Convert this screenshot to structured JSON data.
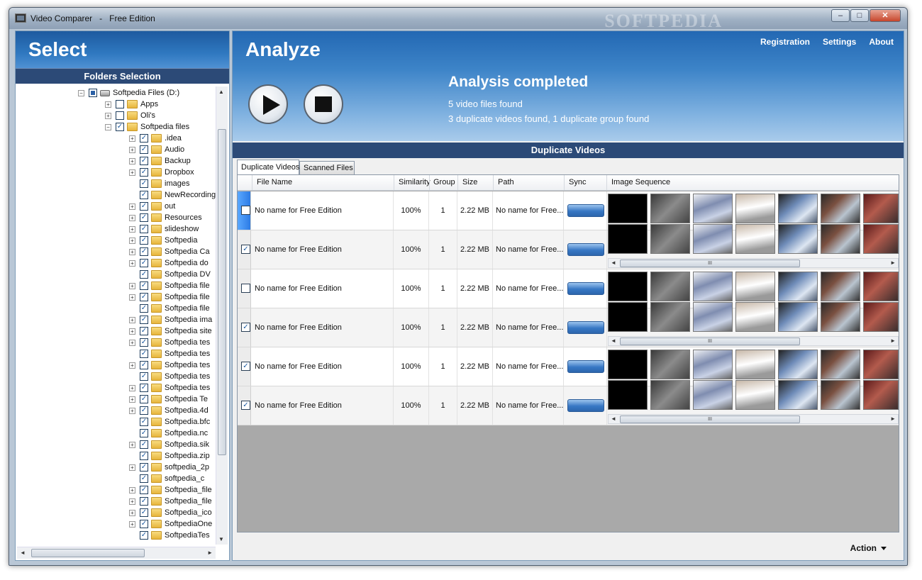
{
  "window": {
    "title": "Video Comparer   -   Free Edition"
  },
  "window_controls": {
    "minimize": "‒",
    "maximize": "□",
    "close": "✕"
  },
  "watermark": "SOFTPEDIA",
  "left_panel": {
    "heading": "Select",
    "subheading": "Folders Selection",
    "tree": [
      {
        "label": "Softpedia Files (D:)",
        "level": 0,
        "type": "drive",
        "expander": "−",
        "check": "partial"
      },
      {
        "label": "Apps",
        "level": 1,
        "type": "folder",
        "expander": "+",
        "check": "none"
      },
      {
        "label": "Oli's",
        "level": 1,
        "type": "folder",
        "expander": "+",
        "check": "none"
      },
      {
        "label": "Softpedia files",
        "level": 1,
        "type": "folder",
        "expander": "−",
        "check": "checked"
      },
      {
        "label": ".idea",
        "level": 2,
        "type": "folder",
        "expander": "+",
        "check": "checked"
      },
      {
        "label": "Audio",
        "level": 2,
        "type": "folder",
        "expander": "+",
        "check": "checked"
      },
      {
        "label": "Backup",
        "level": 2,
        "type": "folder",
        "expander": "+",
        "check": "checked"
      },
      {
        "label": "Dropbox",
        "level": 2,
        "type": "folder",
        "expander": "+",
        "check": "checked"
      },
      {
        "label": "images",
        "level": 2,
        "type": "folder",
        "expander": "",
        "check": "checked"
      },
      {
        "label": "NewRecording",
        "level": 2,
        "type": "folder",
        "expander": "",
        "check": "checked"
      },
      {
        "label": "out",
        "level": 2,
        "type": "folder",
        "expander": "+",
        "check": "checked"
      },
      {
        "label": "Resources",
        "level": 2,
        "type": "folder",
        "expander": "+",
        "check": "checked"
      },
      {
        "label": "slideshow",
        "level": 2,
        "type": "folder",
        "expander": "+",
        "check": "checked"
      },
      {
        "label": "Softpedia",
        "level": 2,
        "type": "folder",
        "expander": "+",
        "check": "checked"
      },
      {
        "label": "Softpedia Ca",
        "level": 2,
        "type": "folder",
        "expander": "+",
        "check": "checked"
      },
      {
        "label": "Softpedia do",
        "level": 2,
        "type": "folder",
        "expander": "+",
        "check": "checked"
      },
      {
        "label": "Softpedia DV",
        "level": 2,
        "type": "folder",
        "expander": "",
        "check": "checked"
      },
      {
        "label": "Softpedia file",
        "level": 2,
        "type": "folder",
        "expander": "+",
        "check": "checked"
      },
      {
        "label": "Softpedia file",
        "level": 2,
        "type": "folder",
        "expander": "+",
        "check": "checked"
      },
      {
        "label": "Softpedia file",
        "level": 2,
        "type": "folder",
        "expander": "",
        "check": "checked"
      },
      {
        "label": "Softpedia ima",
        "level": 2,
        "type": "folder",
        "expander": "+",
        "check": "checked"
      },
      {
        "label": "Softpedia site",
        "level": 2,
        "type": "folder",
        "expander": "+",
        "check": "checked"
      },
      {
        "label": "Softpedia tes",
        "level": 2,
        "type": "folder",
        "expander": "+",
        "check": "checked"
      },
      {
        "label": "Softpedia tes",
        "level": 2,
        "type": "folder",
        "expander": "",
        "check": "checked"
      },
      {
        "label": "Softpedia tes",
        "level": 2,
        "type": "folder",
        "expander": "+",
        "check": "checked"
      },
      {
        "label": "Softpedia tes",
        "level": 2,
        "type": "folder",
        "expander": "",
        "check": "checked"
      },
      {
        "label": "Softpedia tes",
        "level": 2,
        "type": "folder",
        "expander": "+",
        "check": "checked"
      },
      {
        "label": "Softpedia Te",
        "level": 2,
        "type": "folder",
        "expander": "+",
        "check": "checked"
      },
      {
        "label": "Softpedia.4d",
        "level": 2,
        "type": "folder",
        "expander": "+",
        "check": "checked"
      },
      {
        "label": "Softpedia.bfc",
        "level": 2,
        "type": "folder",
        "expander": "",
        "check": "checked"
      },
      {
        "label": "Softpedia.nc",
        "level": 2,
        "type": "folder",
        "expander": "",
        "check": "checked"
      },
      {
        "label": "Softpedia.sik",
        "level": 2,
        "type": "folder",
        "expander": "+",
        "check": "checked"
      },
      {
        "label": "Softpedia.zip",
        "level": 2,
        "type": "folder",
        "expander": "",
        "check": "checked"
      },
      {
        "label": "softpedia_2p",
        "level": 2,
        "type": "folder",
        "expander": "+",
        "check": "checked"
      },
      {
        "label": "softpedia_c",
        "level": 2,
        "type": "folder",
        "expander": "",
        "check": "checked"
      },
      {
        "label": "Softpedia_file",
        "level": 2,
        "type": "folder",
        "expander": "+",
        "check": "checked"
      },
      {
        "label": "Softpedia_file",
        "level": 2,
        "type": "folder",
        "expander": "+",
        "check": "checked"
      },
      {
        "label": "Softpedia_ico",
        "level": 2,
        "type": "folder",
        "expander": "+",
        "check": "checked"
      },
      {
        "label": "SoftpediaOne",
        "level": 2,
        "type": "folder",
        "expander": "+",
        "check": "checked"
      },
      {
        "label": "SoftpediaTes",
        "level": 2,
        "type": "folder",
        "expander": "",
        "check": "checked"
      }
    ]
  },
  "right_panel": {
    "heading": "Analyze",
    "links": [
      "Registration",
      "Settings",
      "About"
    ],
    "status": {
      "title": "Analysis completed",
      "line1": "5 video files found",
      "line2": "3 duplicate videos found, 1 duplicate group found"
    },
    "section_title": "Duplicate Videos",
    "tabs": [
      {
        "label": "Duplicate Videos",
        "active": true
      },
      {
        "label": "Scanned Files",
        "active": false
      }
    ],
    "columns": [
      "File Name",
      "Similarity",
      "Group",
      "Size",
      "Path",
      "Sync",
      "Image Sequence"
    ],
    "rows": [
      {
        "checked": false,
        "current": true,
        "file": "No name for Free Edition",
        "similarity": "100%",
        "group": "1",
        "size": "2.22 MB",
        "path": "No name for Free..."
      },
      {
        "checked": true,
        "current": false,
        "file": "No name for Free Edition",
        "similarity": "100%",
        "group": "1",
        "size": "2.22 MB",
        "path": "No name for Free..."
      },
      {
        "checked": false,
        "current": false,
        "file": "No name for Free Edition",
        "similarity": "100%",
        "group": "1",
        "size": "2.22 MB",
        "path": "No name for Free..."
      },
      {
        "checked": true,
        "current": false,
        "file": "No name for Free Edition",
        "similarity": "100%",
        "group": "1",
        "size": "2.22 MB",
        "path": "No name for Free..."
      },
      {
        "checked": true,
        "current": false,
        "file": "No name for Free Edition",
        "similarity": "100%",
        "group": "1",
        "size": "2.22 MB",
        "path": "No name for Free..."
      },
      {
        "checked": true,
        "current": false,
        "file": "No name for Free Edition",
        "similarity": "100%",
        "group": "1",
        "size": "2.22 MB",
        "path": "No name for Free..."
      }
    ],
    "scroll_grip": "III",
    "action_label": "Action"
  },
  "icons": {
    "play": "play-icon",
    "stop": "stop-icon",
    "check": "✓",
    "arrow_left": "◄",
    "arrow_right": "►",
    "arrow_up": "▲",
    "arrow_down": "▼"
  }
}
